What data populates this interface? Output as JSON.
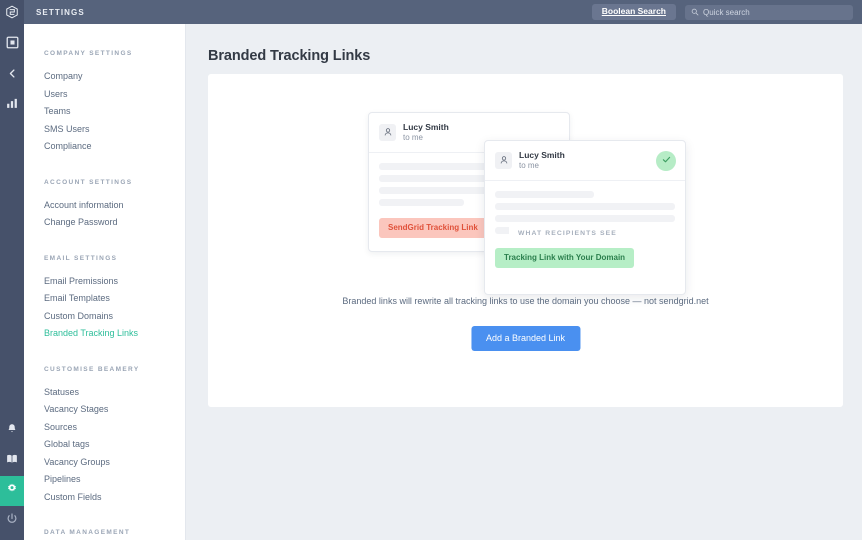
{
  "header": {
    "title": "SETTINGS",
    "logo_icon": "beamery-cube-logo-icon",
    "boolean_search_label": "Boolean Search",
    "search": {
      "placeholder": "Quick search",
      "value": "",
      "icon": "search-icon"
    }
  },
  "rail": {
    "items": [
      {
        "name": "dashboard",
        "icon": "square-outline-icon",
        "active": false
      },
      {
        "name": "collapse",
        "icon": "chevron-left-icon",
        "active": false
      },
      {
        "name": "analytics",
        "icon": "bar-chart-icon",
        "active": false
      }
    ],
    "bottom_items": [
      {
        "name": "notifications",
        "icon": "bell-icon",
        "active": false
      },
      {
        "name": "knowledge",
        "icon": "book-icon",
        "active": false
      },
      {
        "name": "settings",
        "icon": "gear-icon",
        "active": true
      },
      {
        "name": "logout",
        "icon": "power-icon",
        "active": false
      }
    ]
  },
  "sidebar": {
    "groups": [
      {
        "heading": "COMPANY SETTINGS",
        "items": [
          {
            "label": "Company",
            "active": false
          },
          {
            "label": "Users",
            "active": false
          },
          {
            "label": "Teams",
            "active": false
          },
          {
            "label": "SMS Users",
            "active": false
          },
          {
            "label": "Compliance",
            "active": false
          }
        ]
      },
      {
        "heading": "ACCOUNT SETTINGS",
        "items": [
          {
            "label": "Account information",
            "active": false
          },
          {
            "label": "Change Password",
            "active": false
          }
        ]
      },
      {
        "heading": "EMAIL SETTINGS",
        "items": [
          {
            "label": "Email Premissions",
            "active": false
          },
          {
            "label": "Email Templates",
            "active": false
          },
          {
            "label": "Custom Domains",
            "active": false
          },
          {
            "label": "Branded Tracking Links",
            "active": true
          }
        ]
      },
      {
        "heading": "CUSTOMISE BEAMERY",
        "items": [
          {
            "label": "Statuses",
            "active": false
          },
          {
            "label": "Vacancy Stages",
            "active": false
          },
          {
            "label": "Sources",
            "active": false
          },
          {
            "label": "Global tags",
            "active": false
          },
          {
            "label": "Vacancy Groups",
            "active": false
          },
          {
            "label": "Pipelines",
            "active": false
          },
          {
            "label": "Custom Fields",
            "active": false
          }
        ]
      },
      {
        "heading": "DATA MANAGEMENT",
        "items": []
      }
    ]
  },
  "main": {
    "page_title": "Branded Tracking Links",
    "illustration": {
      "back_card": {
        "sender_name": "Lucy Smith",
        "recipient_line": "to me",
        "avatar_icon": "person-icon",
        "badge_label": "SendGrid Tracking Link",
        "badge_color": "#fbc6bd",
        "badge_text_color": "#e0513a"
      },
      "front_card": {
        "sender_name": "Lucy Smith",
        "recipient_line": "to me",
        "avatar_icon": "person-icon",
        "status_icon": "check-circle-icon",
        "status_color": "#b6ecc6",
        "overlay_label": "WHAT RECIPIENTS SEE",
        "badge_label": "Tracking Link with Your Domain",
        "badge_color": "#b6eec6",
        "badge_text_color": "#2b7f4d"
      }
    },
    "caption": "Branded links will rewrite all tracking links to use the domain you choose — not sendgrid.net",
    "add_button_label": "Add a Branded Link"
  },
  "colors": {
    "header_bg": "#56637c",
    "rail_bg": "#46516a",
    "accent_teal": "#2dbe9a",
    "accent_blue": "#4a90f0",
    "page_bg": "#eceff3"
  }
}
